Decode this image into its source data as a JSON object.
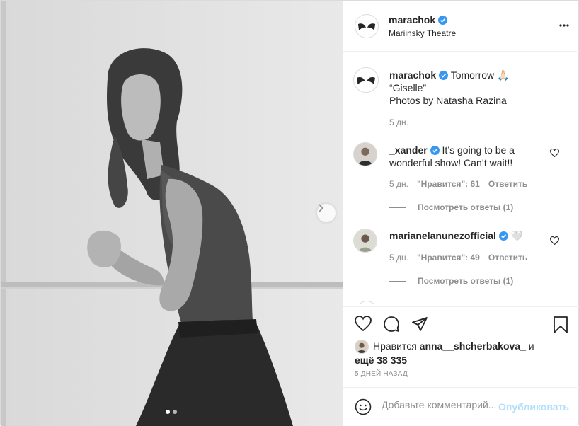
{
  "post": {
    "username": "marachok",
    "location": "Mariinsky Theatre"
  },
  "caption": {
    "username": "marachok",
    "line1": "Tomorrow 🙏🏻",
    "line2": "“Giselle”",
    "line3": "Photos by Natasha Razina",
    "time": "5 дн."
  },
  "comments": [
    {
      "username": "_xander",
      "text": "It’s going to be a wonderful show! Can’t wait!!",
      "time": "5 дн.",
      "likes": "\"Нравится\": 61",
      "reply": "Ответить",
      "view_replies": "Посмотреть ответы (1)"
    },
    {
      "username": "marianelanunezofficial",
      "text": "🤍",
      "time": "5 дн.",
      "likes": "\"Нравится\": 49",
      "reply": "Ответить",
      "view_replies": "Посмотреть ответы (1)"
    }
  ],
  "likes": {
    "prefix": "Нравится",
    "user": "anna__shcherbakova_",
    "connector": "и",
    "rest": "ещё 38 335"
  },
  "posted_ago": "5 ДНЕЙ НАЗАД",
  "composer": {
    "placeholder": "Добавьте комментарий...",
    "publish": "Опубликовать"
  },
  "colors": {
    "verified": "#3897f0",
    "link": "#0095f6",
    "publish_disabled": "#b2dffc"
  },
  "carousel": {
    "slides": 2,
    "active": 1
  }
}
